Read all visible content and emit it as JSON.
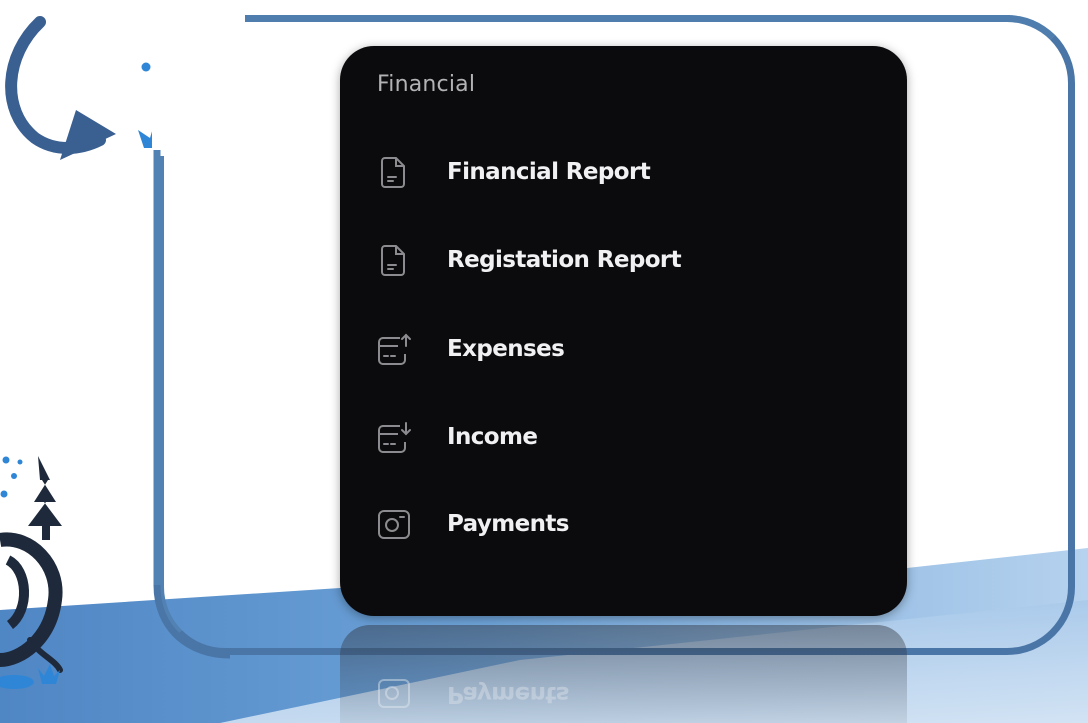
{
  "panel": {
    "title": "Financial",
    "items": [
      {
        "label": "Financial Report",
        "icon": "document-icon"
      },
      {
        "label": "Registation Report",
        "icon": "document-icon"
      },
      {
        "label": "Expenses",
        "icon": "wallet-arrow-up-icon"
      },
      {
        "label": "Income",
        "icon": "wallet-arrow-down-icon"
      },
      {
        "label": "Payments",
        "icon": "card-circle-icon"
      }
    ]
  },
  "reflection": {
    "label": "Payments"
  },
  "colors": {
    "panel_bg": "#0b0b0d",
    "frame": "#4a76a7",
    "accent_blue": "#2f86d6",
    "wave_blue": "#5b92cf",
    "title_gray": "#b3b3b6",
    "label_white": "#f1f1f3"
  }
}
